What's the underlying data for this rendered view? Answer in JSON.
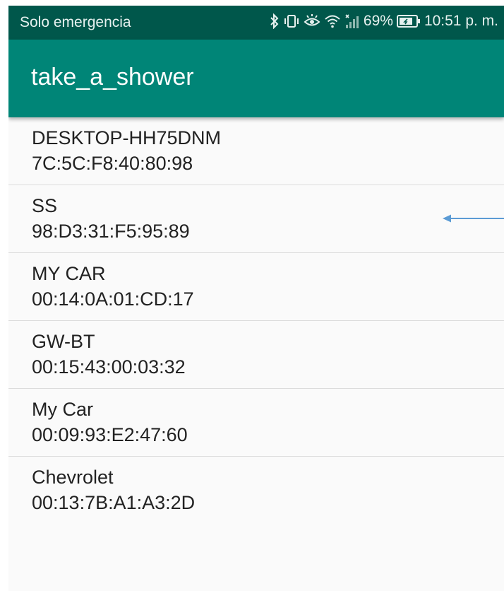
{
  "status_bar": {
    "carrier": "Solo emergencia",
    "battery": "69%",
    "time": "10:51 p. m.",
    "icons": [
      "bluetooth-icon",
      "vibrate-icon",
      "eye-comfort-icon",
      "wifi-icon",
      "no-signal-icon",
      "battery-icon"
    ]
  },
  "app_bar": {
    "title": "take_a_shower",
    "color": "#008577"
  },
  "devices": [
    {
      "name": "DESKTOP-HH75DNM",
      "address": "7C:5C:F8:40:80:98"
    },
    {
      "name": "SS",
      "address": "98:D3:31:F5:95:89"
    },
    {
      "name": "MY CAR",
      "address": "00:14:0A:01:CD:17"
    },
    {
      "name": "GW-BT",
      "address": "00:15:43:00:03:32"
    },
    {
      "name": "My Car",
      "address": "00:09:93:E2:47:60"
    },
    {
      "name": "Chevrolet",
      "address": "00:13:7B:A1:A3:2D"
    }
  ],
  "annotation": {
    "icon": "arrow-left-icon",
    "color": "#5b9bd5"
  }
}
